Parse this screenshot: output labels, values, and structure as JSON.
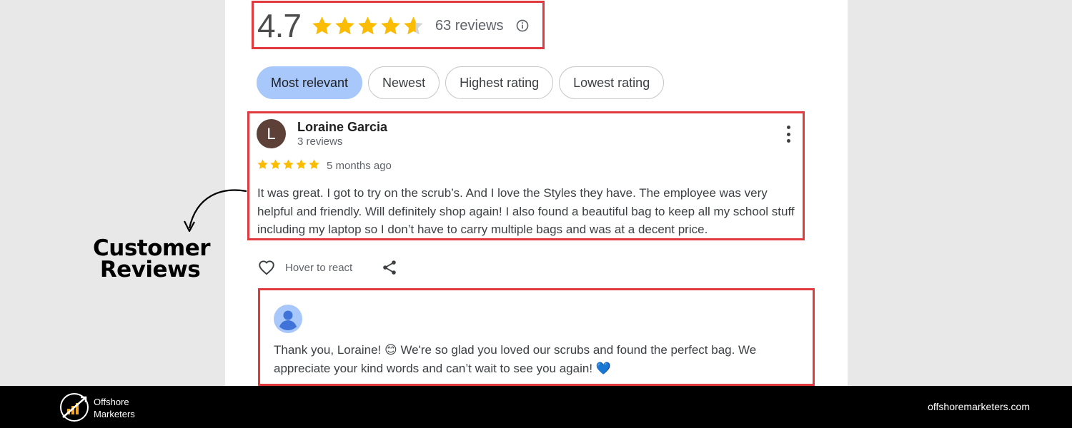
{
  "rating": {
    "value": "4.7",
    "stars_filled": 4.7,
    "review_count": "63 reviews"
  },
  "sort_chips": [
    {
      "label": "Most relevant",
      "active": true
    },
    {
      "label": "Newest",
      "active": false
    },
    {
      "label": "Highest rating",
      "active": false
    },
    {
      "label": "Lowest rating",
      "active": false
    }
  ],
  "review": {
    "avatar_initial": "L",
    "avatar_color": "#5d4037",
    "name": "Loraine Garcia",
    "reviewer_meta": "3 reviews",
    "stars": 5,
    "time": "5 months ago",
    "text": "It was great. I got to try on the scrub’s. And I love the Styles they have. The employee was very helpful and friendly. Will definitely shop again! I also found a beautiful bag to keep all my school stuff including my laptop so I don’t have to carry multiple bags and was at a decent price."
  },
  "actions": {
    "react_label": "Hover to react"
  },
  "owner_reply": {
    "text_before_emoji": "Thank you, Loraine! ",
    "emoji_1": "😊",
    "text_middle": " We're so glad you loved our scrubs and found the perfect bag. We appreciate your kind words and can’t wait to see you again! ",
    "emoji_2": "💙"
  },
  "annotation": {
    "line1": "Customer",
    "line2": "Reviews"
  },
  "footer": {
    "brand_line1": "Offshore",
    "brand_line2": "Marketers",
    "url": "offshoremarketers.com"
  },
  "colors": {
    "star": "#fbbc04",
    "highlight_border": "#e0393e",
    "active_chip": "#a8c7fa"
  }
}
